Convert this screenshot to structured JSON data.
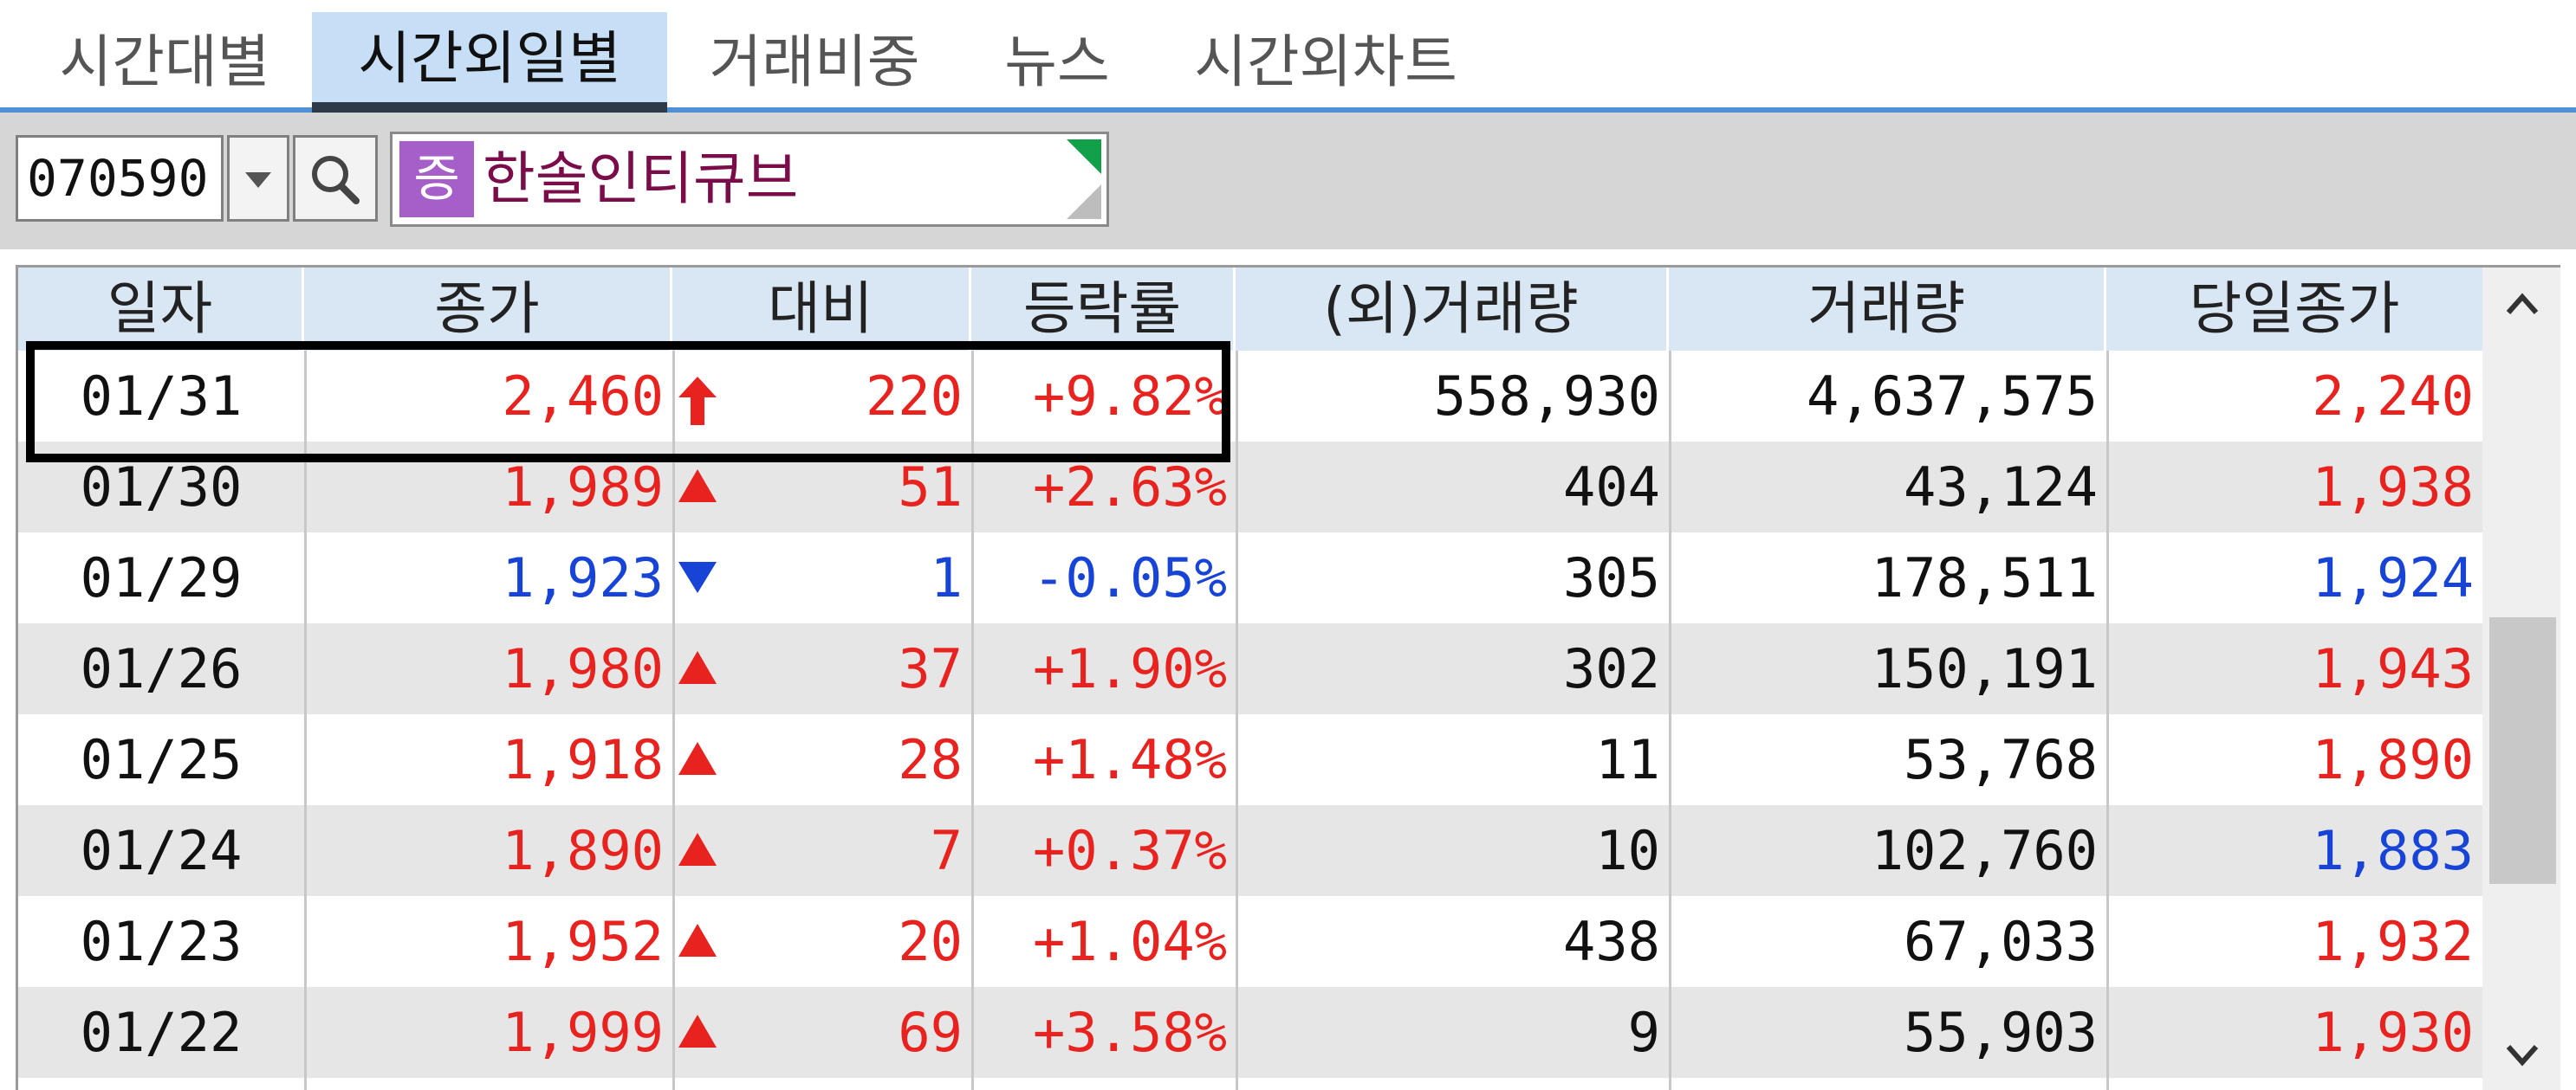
{
  "tabs": [
    {
      "label": "시간대별",
      "active": false
    },
    {
      "label": "시간외일별",
      "active": true
    },
    {
      "label": "거래비중",
      "active": false
    },
    {
      "label": "뉴스",
      "active": false
    },
    {
      "label": "시간외차트",
      "active": false
    }
  ],
  "toolbar": {
    "code": "070590",
    "badge": "증",
    "stock_name": "한솔인티큐브"
  },
  "table": {
    "headers": [
      "일자",
      "종가",
      "대비",
      "등락률",
      "(외)거래량",
      "거래량",
      "당일종가"
    ],
    "rows": [
      {
        "date": "01/31",
        "close": "2,460",
        "arrow": "limit-up",
        "change": "220",
        "rate": "+9.82%",
        "ext_volume": "558,930",
        "volume": "4,637,575",
        "day_close": "2,240",
        "dir": "up",
        "day_dir": "up"
      },
      {
        "date": "01/30",
        "close": "1,989",
        "arrow": "up",
        "change": "51",
        "rate": "+2.63%",
        "ext_volume": "404",
        "volume": "43,124",
        "day_close": "1,938",
        "dir": "up",
        "day_dir": "up"
      },
      {
        "date": "01/29",
        "close": "1,923",
        "arrow": "down",
        "change": "1",
        "rate": "-0.05%",
        "ext_volume": "305",
        "volume": "178,511",
        "day_close": "1,924",
        "dir": "down",
        "day_dir": "down"
      },
      {
        "date": "01/26",
        "close": "1,980",
        "arrow": "up",
        "change": "37",
        "rate": "+1.90%",
        "ext_volume": "302",
        "volume": "150,191",
        "day_close": "1,943",
        "dir": "up",
        "day_dir": "up"
      },
      {
        "date": "01/25",
        "close": "1,918",
        "arrow": "up",
        "change": "28",
        "rate": "+1.48%",
        "ext_volume": "11",
        "volume": "53,768",
        "day_close": "1,890",
        "dir": "up",
        "day_dir": "up"
      },
      {
        "date": "01/24",
        "close": "1,890",
        "arrow": "up",
        "change": "7",
        "rate": "+0.37%",
        "ext_volume": "10",
        "volume": "102,760",
        "day_close": "1,883",
        "dir": "up",
        "day_dir": "down"
      },
      {
        "date": "01/23",
        "close": "1,952",
        "arrow": "up",
        "change": "20",
        "rate": "+1.04%",
        "ext_volume": "438",
        "volume": "67,033",
        "day_close": "1,932",
        "dir": "up",
        "day_dir": "up"
      },
      {
        "date": "01/22",
        "close": "1,999",
        "arrow": "up",
        "change": "69",
        "rate": "+3.58%",
        "ext_volume": "9",
        "volume": "55,903",
        "day_close": "1,930",
        "dir": "up",
        "day_dir": "up"
      }
    ]
  },
  "colors": {
    "up": "#e8231f",
    "down": "#1744d6",
    "neutral": "#111111",
    "tab_accent": "#4f8fd6"
  },
  "icons": {
    "dropdown": "chevron-down-icon",
    "search": "search-icon",
    "scroll_up": "chevron-up-icon",
    "scroll_down": "chevron-down-icon"
  }
}
